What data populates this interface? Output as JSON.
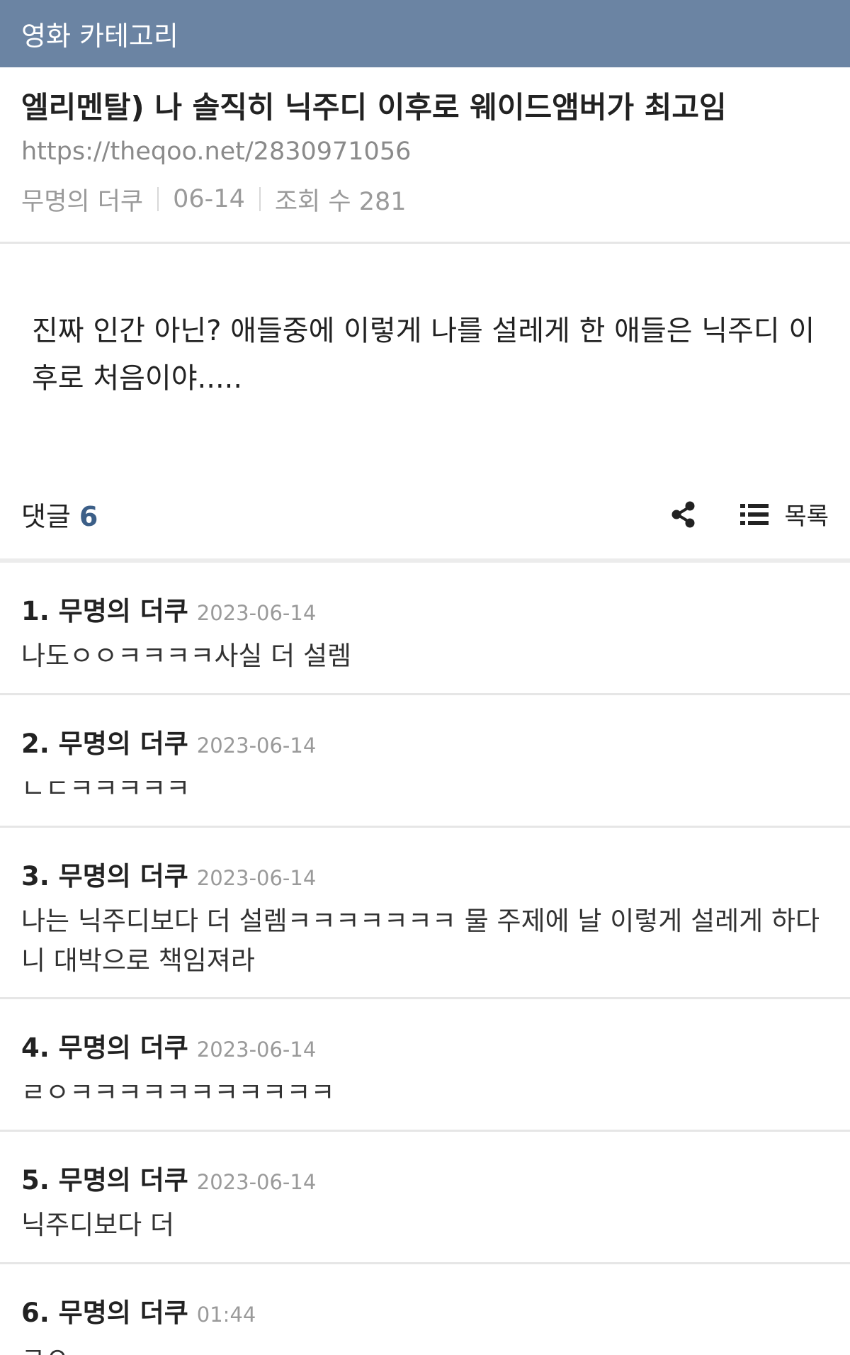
{
  "header": {
    "category": "영화 카테고리"
  },
  "post": {
    "title": "엘리멘탈) 나 솔직히 닉주디 이후로 웨이드앰버가 최고임",
    "url": "https://theqoo.net/2830971056",
    "author": "무명의 더쿠",
    "date": "06-14",
    "views": "조회 수 281",
    "body": "진짜 인간 아닌? 애들중에 이렇게 나를 설레게 한 애들은 닉주디 이후로 처음이야....."
  },
  "comment_bar": {
    "label": "댓글",
    "count": "6",
    "share_icon": "share-icon",
    "list_icon": "list-icon",
    "list_label": "목록"
  },
  "comments": [
    {
      "author": "1. 무명의 더쿠",
      "date": "2023-06-14",
      "text": "나도ㅇㅇㅋㅋㅋㅋ사실 더 설렘"
    },
    {
      "author": "2. 무명의 더쿠",
      "date": "2023-06-14",
      "text": "ㄴㄷㅋㅋㅋㅋㅋ"
    },
    {
      "author": "3. 무명의 더쿠",
      "date": "2023-06-14",
      "text": "나는 닉주디보다 더 설렘ㅋㅋㅋㅋㅋㅋㅋ 물 주제에 날 이렇게 설레게 하다니 대박으로 책임져라"
    },
    {
      "author": "4. 무명의 더쿠",
      "date": "2023-06-14",
      "text": "ㄹㅇㅋㅋㅋㅋㅋㅋㅋㅋㅋㅋㅋ"
    },
    {
      "author": "5. 무명의 더쿠",
      "date": "2023-06-14",
      "text": "닉주디보다 더"
    },
    {
      "author": "6. 무명의 더쿠",
      "date": "01:44",
      "text": "ㄹㅇ"
    }
  ]
}
